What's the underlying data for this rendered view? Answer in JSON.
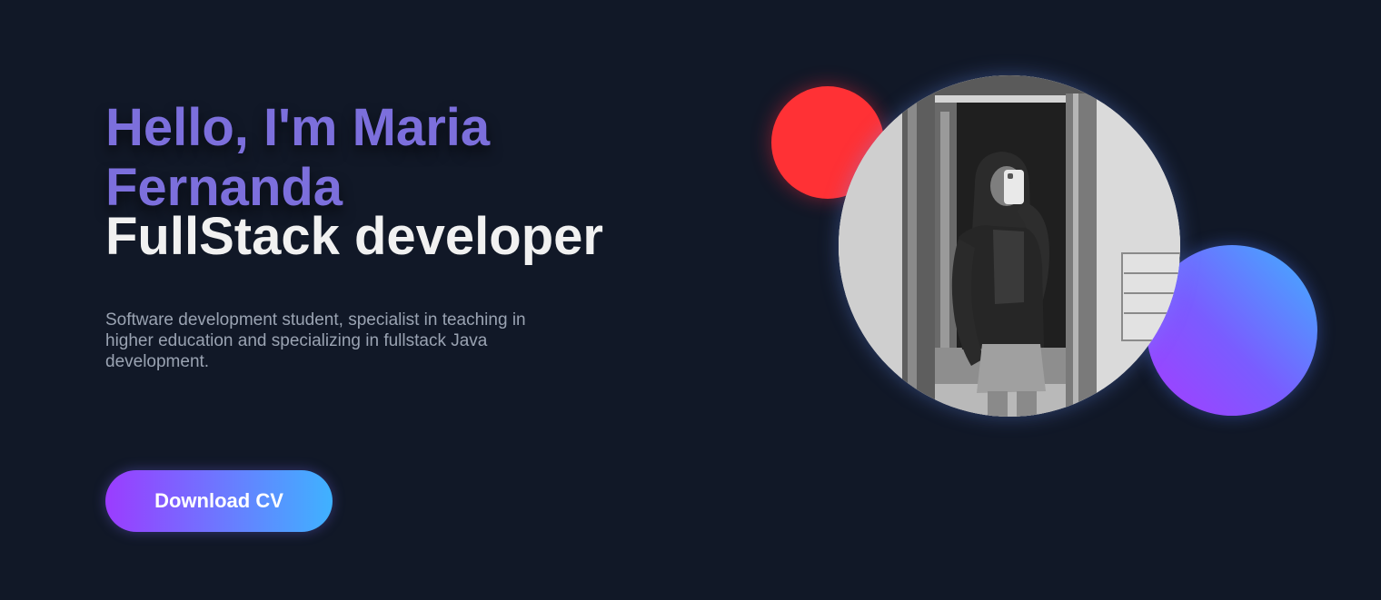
{
  "hero": {
    "greeting": "Hello, I'm Maria Fernanda",
    "role": "FullStack developer",
    "description": "Software development student, specialist in teaching in higher education and specializing in fullstack Java development.",
    "cta_label": "Download CV"
  },
  "colors": {
    "background": "#111827",
    "greeting": "#7c6fdc",
    "role": "#f1f1f1",
    "description": "#9aa3b2",
    "button_gradient_start": "#9b3cff",
    "button_gradient_end": "#3fb2ff",
    "accent_red": "#ff3135",
    "accent_blue": "#3fb2ff",
    "accent_purple": "#a53cff"
  },
  "profile_photo": {
    "style": "grayscale"
  }
}
